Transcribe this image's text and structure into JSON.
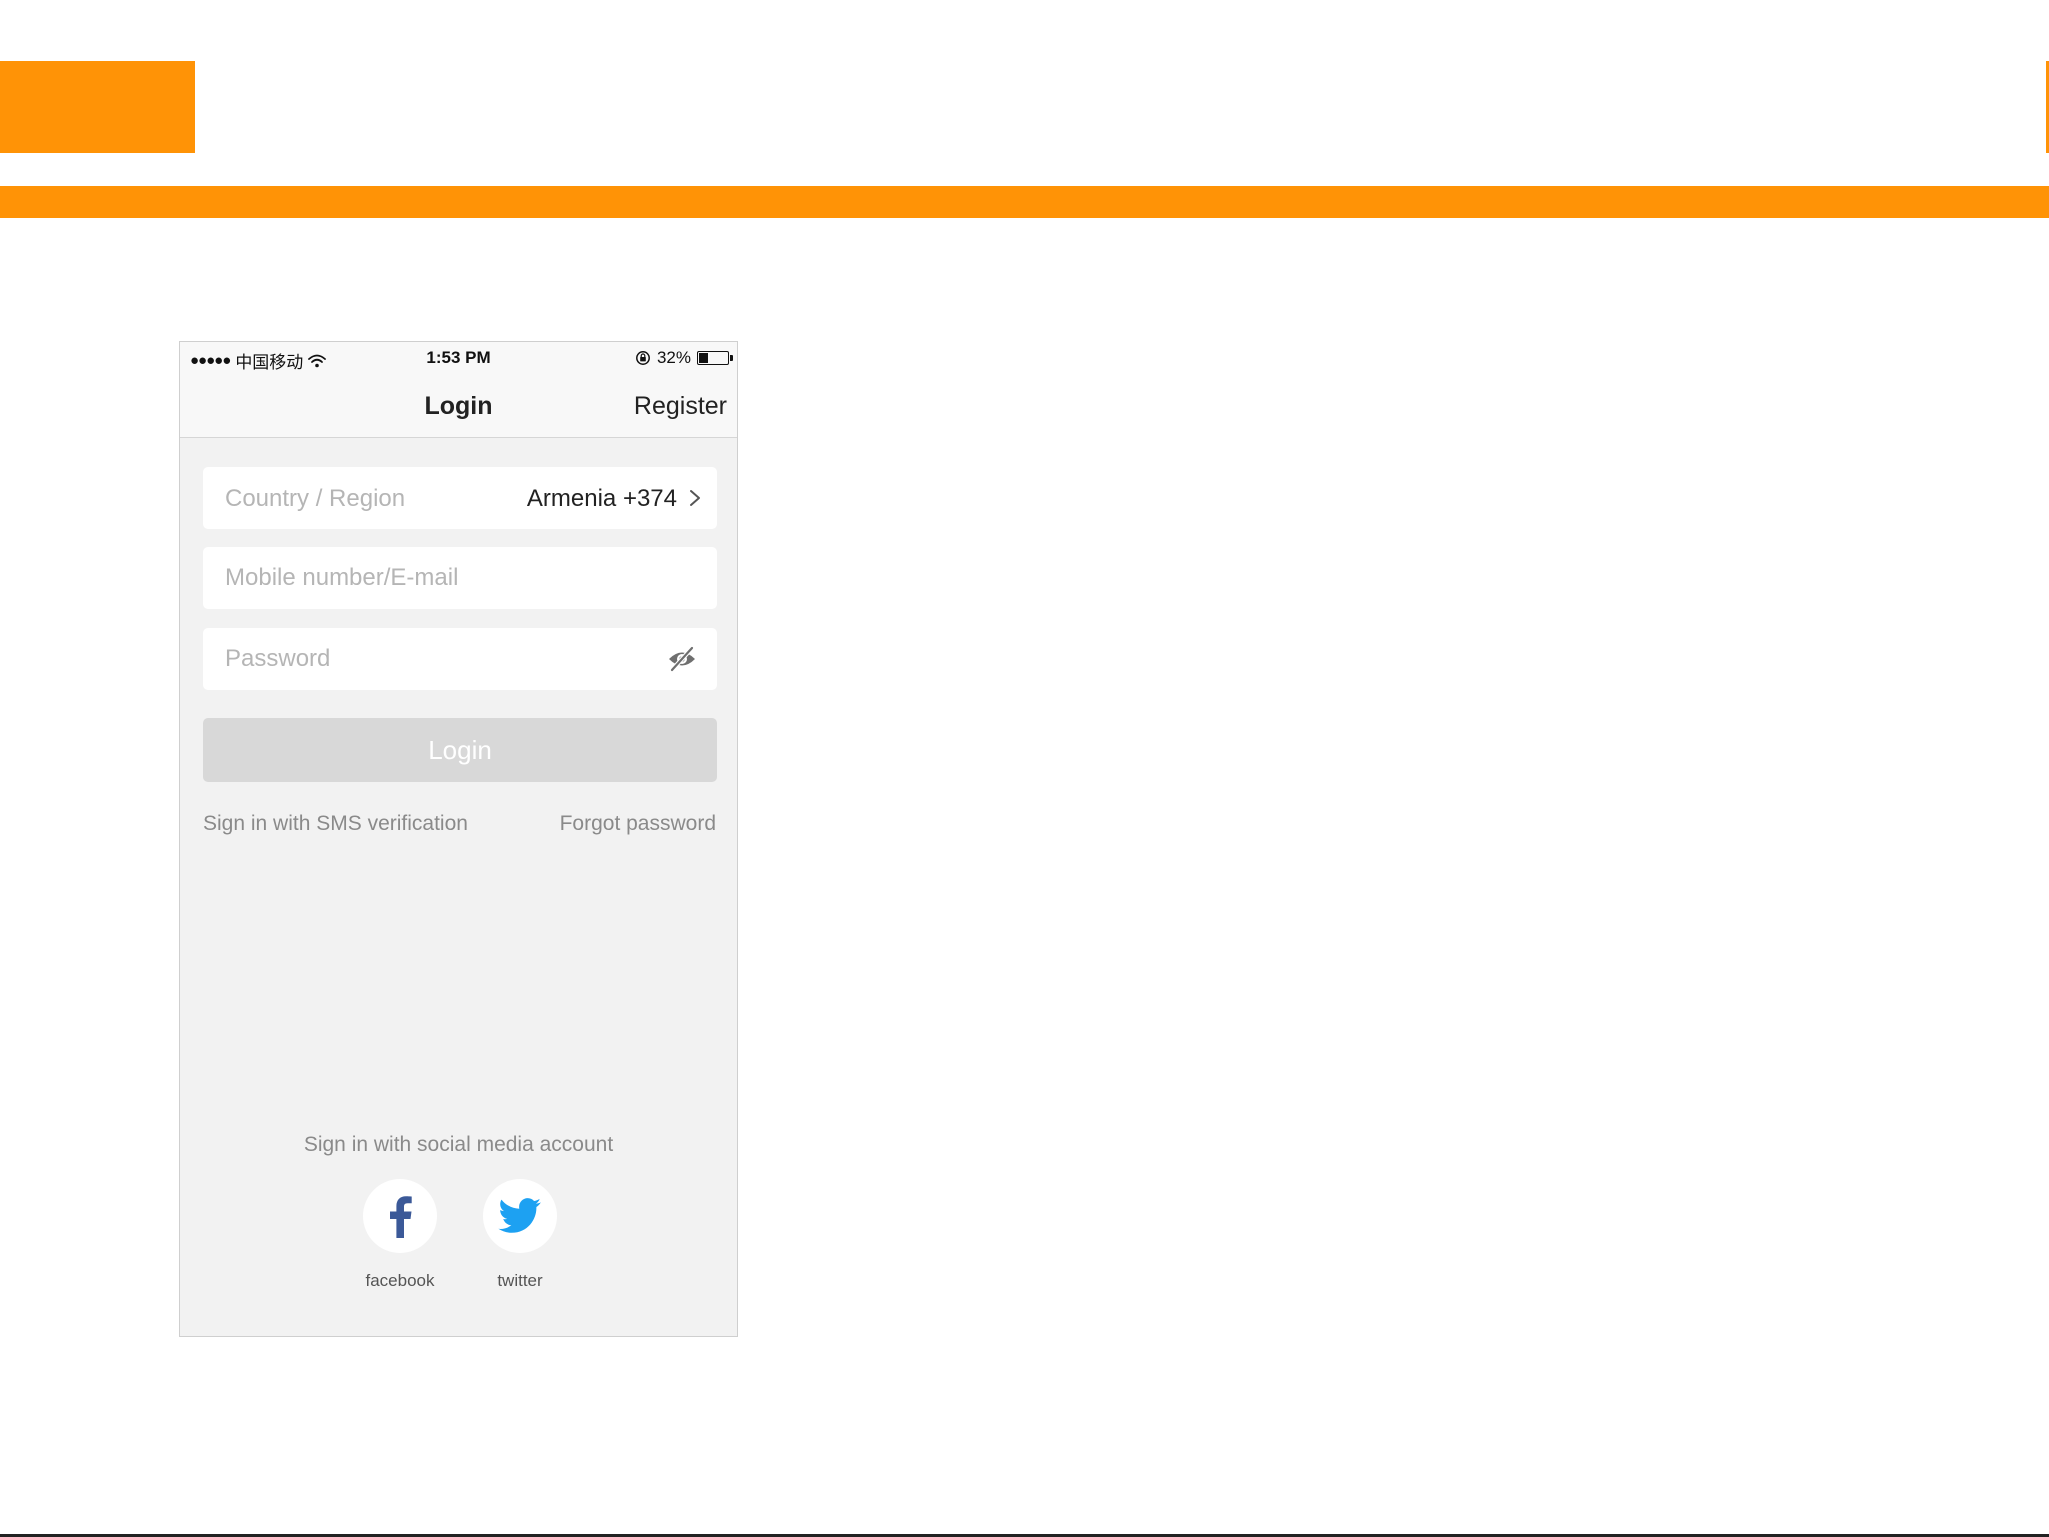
{
  "colors": {
    "accent": "#ff9306",
    "screen_background": "#f2f2f2",
    "disabled_button": "#d8d8d8",
    "facebook_blue": "#3b5998",
    "twitter_blue": "#1da1f2"
  },
  "status_bar": {
    "signal": "●●●●●",
    "carrier": "中国移动",
    "time": "1:53 PM",
    "battery": "32%",
    "battery_level": 0.32
  },
  "nav": {
    "title": "Login",
    "register": "Register"
  },
  "form": {
    "country_label": "Country / Region",
    "country_value": "Armenia +374",
    "account_placeholder": "Mobile number/E-mail",
    "account_value": "",
    "password_placeholder": "Password",
    "password_value": ""
  },
  "login_button": "Login",
  "links": {
    "sms": "Sign in with SMS verification",
    "forgot": "Forgot password"
  },
  "social": {
    "title": "Sign in with social media account",
    "items": [
      {
        "label": "facebook",
        "icon": "facebook-icon"
      },
      {
        "label": "twitter",
        "icon": "twitter-icon"
      }
    ]
  }
}
